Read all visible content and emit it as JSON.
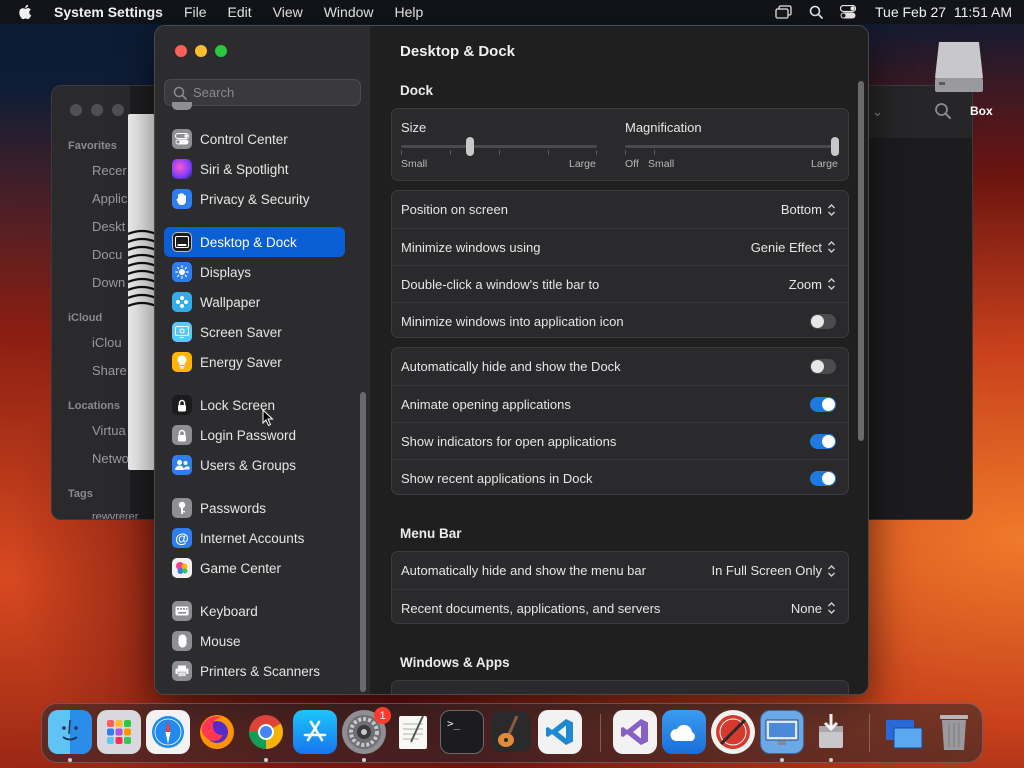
{
  "menubar": {
    "app_name": "System Settings",
    "menus": [
      "File",
      "Edit",
      "View",
      "Window",
      "Help"
    ],
    "clock": "Tue Feb 27  11:51 AM"
  },
  "background_finder": {
    "sections": [
      "Favorites",
      "iCloud",
      "Locations",
      "Tags"
    ],
    "items": [
      "Recer",
      "Applic",
      "Deskt",
      "Docu",
      "Down",
      "iClou",
      "Share",
      "Virtua",
      "Netwo",
      "rewvrerer"
    ]
  },
  "desktop": {
    "drive_label": "Box"
  },
  "sidebar": {
    "search_placeholder": "Search",
    "items": [
      {
        "label": "Control Center",
        "icon": "control-center-icon",
        "color": "#8e8e93"
      },
      {
        "label": "Siri & Spotlight",
        "icon": "siri-icon",
        "color": "#b43cdc"
      },
      {
        "label": "Privacy & Security",
        "icon": "hand-icon",
        "color": "#2f7ef0"
      },
      {
        "label": "Desktop & Dock",
        "icon": "dock-icon",
        "color": "#1c1c1e",
        "active": true
      },
      {
        "label": "Displays",
        "icon": "sun-icon",
        "color": "#2f7ef0"
      },
      {
        "label": "Wallpaper",
        "icon": "wallpaper-icon",
        "color": "#32ade6"
      },
      {
        "label": "Screen Saver",
        "icon": "screen-saver-icon",
        "color": "#5ac8fa"
      },
      {
        "label": "Energy Saver",
        "icon": "bulb-icon",
        "color": "#ffb400"
      },
      {
        "label": "Lock Screen",
        "icon": "lock-icon",
        "color": "#1c1c1e"
      },
      {
        "label": "Login Password",
        "icon": "lock-icon",
        "color": "#8e8e93"
      },
      {
        "label": "Users & Groups",
        "icon": "users-icon",
        "color": "#2f7ef0"
      },
      {
        "label": "Passwords",
        "icon": "key-icon",
        "color": "#8e8e93"
      },
      {
        "label": "Internet Accounts",
        "icon": "at-icon",
        "color": "#2f7ef0"
      },
      {
        "label": "Game Center",
        "icon": "game-center-icon",
        "color": "#e8e8e8"
      },
      {
        "label": "Keyboard",
        "icon": "keyboard-icon",
        "color": "#8e8e93"
      },
      {
        "label": "Mouse",
        "icon": "mouse-icon",
        "color": "#8e8e93"
      },
      {
        "label": "Printers & Scanners",
        "icon": "printer-icon",
        "color": "#8e8e93"
      }
    ]
  },
  "main": {
    "title": "Desktop & Dock",
    "dock_section": "Dock",
    "size_slider": {
      "label": "Size",
      "min_label": "Small",
      "max_label": "Large",
      "value": 0.35
    },
    "magnification_slider": {
      "label": "Magnification",
      "off_label": "Off",
      "min_label": "Small",
      "max_label": "Large",
      "value": 1.0
    },
    "dock_options": [
      {
        "label": "Position on screen",
        "value": "Bottom"
      },
      {
        "label": "Minimize windows using",
        "value": "Genie Effect"
      },
      {
        "label": "Double-click a window's title bar to",
        "value": "Zoom"
      }
    ],
    "minimize_into_icon": {
      "label": "Minimize windows into application icon",
      "on": false
    },
    "dock_toggles": [
      {
        "label": "Automatically hide and show the Dock",
        "on": false
      },
      {
        "label": "Animate opening applications",
        "on": true
      },
      {
        "label": "Show indicators for open applications",
        "on": true
      },
      {
        "label": "Show recent applications in Dock",
        "on": true
      }
    ],
    "menubar_section": "Menu Bar",
    "menubar_options": [
      {
        "label": "Automatically hide and show the menu bar",
        "value": "In Full Screen Only"
      },
      {
        "label": "Recent documents, applications, and servers",
        "value": "None"
      }
    ],
    "windows_section": "Windows & Apps"
  },
  "dock": {
    "apps": [
      "finder-icon",
      "launchpad-icon",
      "safari-icon",
      "firefox-icon",
      "chrome-icon",
      "app-store-icon",
      "system-settings-icon",
      "textedit-icon",
      "terminal-icon",
      "garageband-icon",
      "vscode-icon",
      "visual-studio-icon",
      "weather-icon",
      "instruments-icon",
      "migration-icon",
      "installer-icon",
      "downloads-icon",
      "trash-icon"
    ],
    "settings_badge": "1"
  },
  "colors": {
    "accent": "#0a5fd4",
    "toggle_on": "#1f7ae0"
  }
}
